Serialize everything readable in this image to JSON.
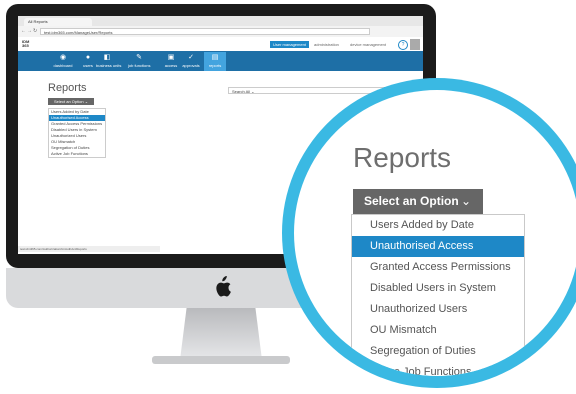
{
  "browser": {
    "tab_title": "All Reports",
    "url": "test.idm365.com/ManageUser/Reports"
  },
  "app": {
    "logo_top": "IDM",
    "logo_bottom": "365",
    "top_links": {
      "user_management": "User management",
      "administration": "administration",
      "device_management": "device management",
      "help": "?"
    },
    "nav": [
      {
        "label": "dashboard",
        "icon": "dashboard-icon",
        "glyph": "◉"
      },
      {
        "label": "users",
        "icon": "user-icon",
        "glyph": "●"
      },
      {
        "label": "business units",
        "icon": "business-units-icon",
        "glyph": "◧"
      },
      {
        "label": "job functions",
        "icon": "wrench-icon",
        "glyph": "✎"
      },
      {
        "label": "access",
        "icon": "lock-icon",
        "glyph": "▣"
      },
      {
        "label": "approvals",
        "icon": "check-icon",
        "glyph": "✓"
      },
      {
        "label": "reports",
        "icon": "reports-icon",
        "glyph": "▤"
      }
    ],
    "active_nav": "reports"
  },
  "page": {
    "title": "Reports",
    "select_label": "Select an Option",
    "chevron": "⌄",
    "search_placeholder": "Search All ⌄",
    "search_icon": "⌕",
    "options": [
      "Users Added by Date",
      "Unauthorised Access",
      "Granted Access Permissions",
      "Disabled Users in System",
      "Unauthorized Users",
      "OU Mismatch",
      "Segregation of Duties",
      "Active Job Functions"
    ],
    "selected_index": 1,
    "status_bar": "test.idm365.com/Authorization/UnAuthAccReports"
  },
  "colors": {
    "accent": "#1e88c7",
    "nav_bar": "#1e6fa6",
    "ring": "#3ab9e3"
  }
}
